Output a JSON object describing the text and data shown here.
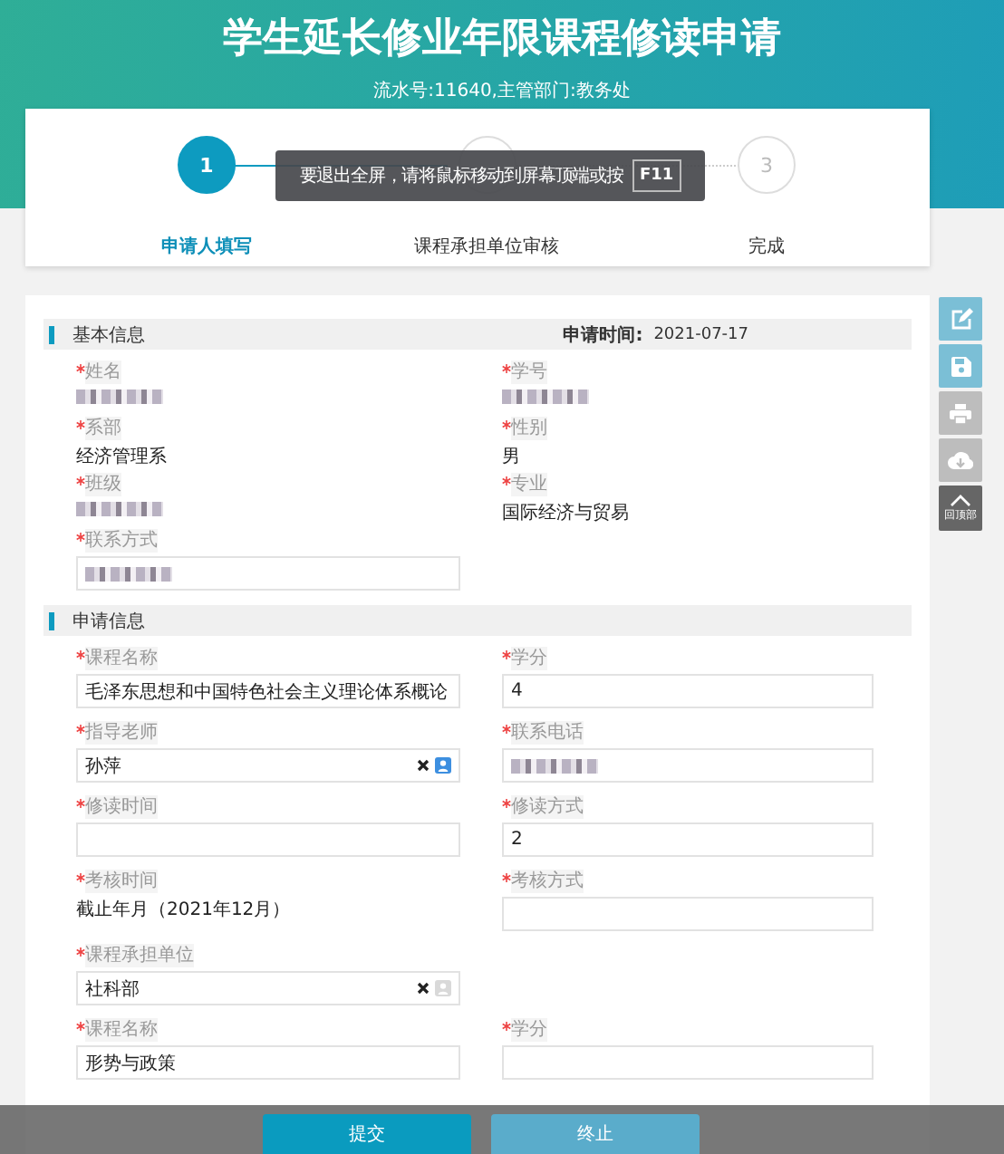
{
  "header": {
    "title": "学生延长修业年限课程修读申请",
    "subtitle": "流水号:11640,主管部门:教务处"
  },
  "steps": [
    {
      "number": "1",
      "label": "申请人填写",
      "selected": true
    },
    {
      "label": "课程承担单位审核",
      "selected": false
    },
    {
      "number": "3",
      "label": "完成",
      "selected": false
    }
  ],
  "tooltip": {
    "text": "要退出全屏，请将鼠标移动到屏幕顶端或按",
    "key": "F11"
  },
  "sections": [
    {
      "title": "基本信息",
      "meta_label": "申请时间:",
      "meta_value": "2021-07-17",
      "rows": [
        [
          {
            "label": "姓名",
            "required": true,
            "kind": "static",
            "redacted": true
          },
          {
            "label": "学号",
            "required": true,
            "kind": "static",
            "redacted": true
          }
        ],
        [
          {
            "label": "系部",
            "required": true,
            "kind": "static",
            "value": "经济管理系"
          },
          {
            "label": "性别",
            "required": true,
            "kind": "static",
            "value": "男"
          }
        ],
        [
          {
            "label": "班级",
            "required": true,
            "kind": "static",
            "redacted": true
          },
          {
            "label": "专业",
            "required": true,
            "kind": "static",
            "value": "国际经济与贸易"
          }
        ],
        [
          {
            "label": "联系方式",
            "required": true,
            "kind": "input",
            "redacted": true
          }
        ]
      ]
    },
    {
      "title": "申请信息",
      "rows": [
        [
          {
            "label": "课程名称",
            "required": true,
            "kind": "input",
            "value": "毛泽东思想和中国特色社会主义理论体系概论"
          },
          {
            "label": "学分",
            "required": true,
            "kind": "input",
            "value": "4"
          }
        ],
        [
          {
            "label": "指导老师",
            "required": true,
            "kind": "picker",
            "value": "孙萍",
            "picker_enabled": true
          },
          {
            "label": "联系电话",
            "required": true,
            "kind": "input",
            "redacted": true
          }
        ],
        [
          {
            "label": "修读时间",
            "required": true,
            "kind": "input"
          },
          {
            "label": "修读方式",
            "required": true,
            "kind": "input",
            "value": "2"
          }
        ],
        [
          {
            "label": "考核时间",
            "required": true,
            "kind": "static",
            "value": "截止年月（2021年12月）"
          },
          {
            "label": "考核方式",
            "required": true,
            "kind": "input"
          }
        ],
        [
          {
            "label": "课程承担单位",
            "required": true,
            "kind": "picker",
            "value": "社科部",
            "picker_enabled": false
          }
        ],
        [
          {
            "label": "课程名称",
            "required": true,
            "kind": "input",
            "value": "形势与政策"
          },
          {
            "label": "学分",
            "required": true,
            "kind": "input"
          }
        ]
      ]
    }
  ],
  "side_tools": [
    {
      "kind": "edit",
      "enabled": true
    },
    {
      "kind": "save",
      "enabled": true
    },
    {
      "kind": "print",
      "enabled": false
    },
    {
      "kind": "download",
      "enabled": false
    },
    {
      "kind": "top",
      "label": "回顶部"
    }
  ],
  "buttons": [
    {
      "label": "提交",
      "kind": "primary"
    },
    {
      "label": "终止",
      "kind": "secondary"
    }
  ]
}
